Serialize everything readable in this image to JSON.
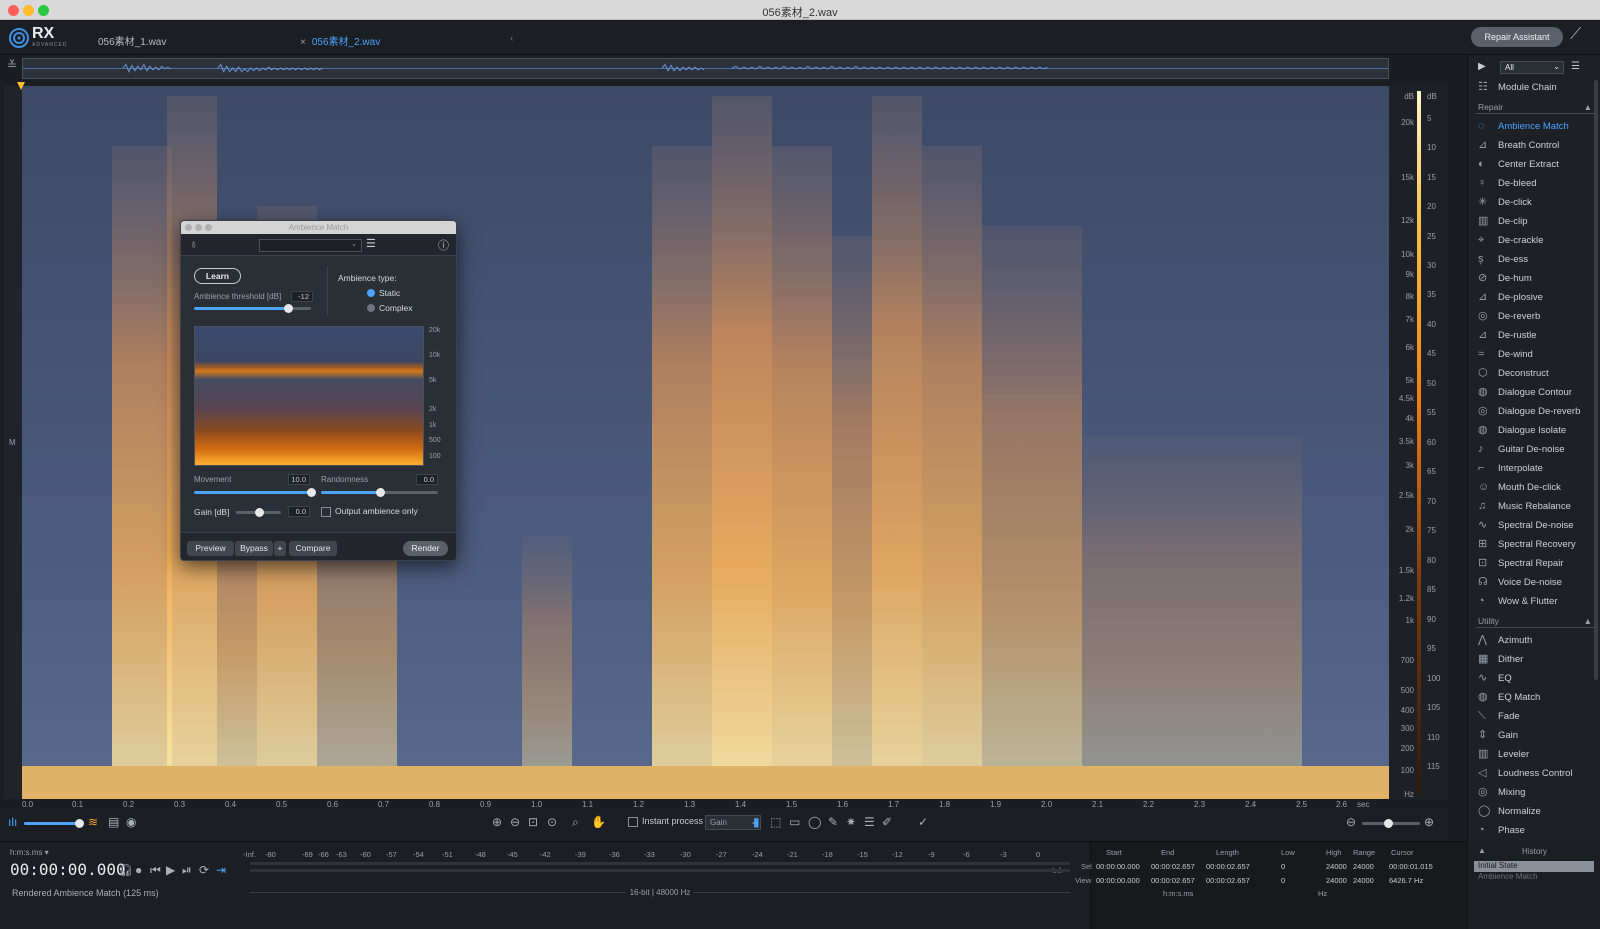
{
  "window": {
    "title": "056素材_2.wav"
  },
  "app": {
    "logo": "RX",
    "logo_sub": "ADVANCED"
  },
  "tabs": [
    {
      "label": "056素材_1.wav",
      "active": false
    },
    {
      "label": "056素材_2.wav",
      "active": true
    }
  ],
  "header": {
    "repair_assistant": "Repair Assistant"
  },
  "hz_axis": [
    "dB",
    "20k",
    "15k",
    "12k",
    "10k",
    "9k",
    "8k",
    "7k",
    "6k",
    "5k",
    "4.5k",
    "4k",
    "3.5k",
    "3k",
    "2.5k",
    "2k",
    "1.5k",
    "1.2k",
    "1k",
    "700",
    "500",
    "400",
    "300",
    "200",
    "100",
    "Hz"
  ],
  "db_axis": [
    "dB",
    "5",
    "10",
    "15",
    "20",
    "25",
    "30",
    "35",
    "40",
    "45",
    "50",
    "55",
    "60",
    "65",
    "70",
    "75",
    "80",
    "85",
    "90",
    "95",
    "100",
    "105",
    "110",
    "115"
  ],
  "time_axis": [
    "0.0",
    "0.1",
    "0.2",
    "0.3",
    "0.4",
    "0.5",
    "0.6",
    "0.7",
    "0.8",
    "0.9",
    "1.0",
    "1.1",
    "1.2",
    "1.3",
    "1.4",
    "1.5",
    "1.6",
    "1.7",
    "1.8",
    "1.9",
    "2.0",
    "2.1",
    "2.2",
    "2.3",
    "2.4",
    "2.5",
    "2.6",
    "sec"
  ],
  "spectrogram_left_label": "M",
  "toolbar": {
    "instant_process": "Instant process",
    "gain_select": "Gain"
  },
  "transport": {
    "time_format": "h:m:s.ms",
    "timecode": "00:00:00.000",
    "status": "Rendered Ambience Match (125 ms)"
  },
  "meter": {
    "labels": [
      "-Inf.",
      "-80",
      "-69",
      "-66",
      "-63",
      "-60",
      "-57",
      "-54",
      "-51",
      "-48",
      "-45",
      "-42",
      "-39",
      "-36",
      "-33",
      "-30",
      "-27",
      "-24",
      "-21",
      "-18",
      "-15",
      "-12",
      "-9",
      "-6",
      "-3",
      "0"
    ],
    "right_label": "-Inf.",
    "format": "16-bit | 48000 Hz"
  },
  "selection": {
    "headers": [
      "Start",
      "End",
      "Length",
      "Low",
      "High",
      "Range",
      "Cursor"
    ],
    "sel_label": "Sel",
    "view_label": "View",
    "sel": [
      "00:00:00.000",
      "00:00:02.657",
      "00:00:02.657",
      "0",
      "24000",
      "24000",
      "00:00:01.015"
    ],
    "view": [
      "00:00:00.000",
      "00:00:02.657",
      "00:00:02.657",
      "0",
      "24000",
      "24000",
      "6426.7 Hz"
    ],
    "unit_time": "h:m:s.ms",
    "unit_freq": "Hz"
  },
  "history": {
    "title": "History",
    "items": [
      "Initial State",
      "Ambience Match"
    ]
  },
  "right_panel": {
    "filter": "All",
    "module_chain": "Module Chain",
    "repair_header": "Repair",
    "repair_items": [
      "Ambience Match",
      "Breath Control",
      "Center Extract",
      "De-bleed",
      "De-click",
      "De-clip",
      "De-crackle",
      "De-ess",
      "De-hum",
      "De-plosive",
      "De-reverb",
      "De-rustle",
      "De-wind",
      "Deconstruct",
      "Dialogue Contour",
      "Dialogue De-reverb",
      "Dialogue Isolate",
      "Guitar De-noise",
      "Interpolate",
      "Mouth De-click",
      "Music Rebalance",
      "Spectral De-noise",
      "Spectral Recovery",
      "Spectral Repair",
      "Voice De-noise",
      "Wow & Flutter"
    ],
    "utility_header": "Utility",
    "utility_items": [
      "Azimuth",
      "Dither",
      "EQ",
      "EQ Match",
      "Fade",
      "Gain",
      "Leveler",
      "Loudness Control",
      "Mixing",
      "Normalize",
      "Phase"
    ]
  },
  "dialog": {
    "title": "Ambience Match",
    "learn": "Learn",
    "threshold_label": "Ambience threshold [dB]",
    "threshold_value": "-12",
    "threshold_level": 0.8,
    "ambience_type_label": "Ambience type:",
    "type_options": [
      "Static",
      "Complex"
    ],
    "type_selected": "Static",
    "mini_axis": [
      "20k",
      "10k",
      "5k",
      "2k",
      "1k",
      "500",
      "100"
    ],
    "movement_label": "Movement",
    "movement_value": "10.0",
    "movement_level": 1.0,
    "randomness_label": "Randomness",
    "randomness_value": "0.0",
    "randomness_level": 0.5,
    "gain_label": "Gain [dB]",
    "gain_value": "0.0",
    "gain_level": 0.5,
    "output_only": "Output ambience only",
    "buttons": {
      "preview": "Preview",
      "bypass": "Bypass",
      "plus": "+",
      "compare": "Compare",
      "render": "Render"
    }
  }
}
